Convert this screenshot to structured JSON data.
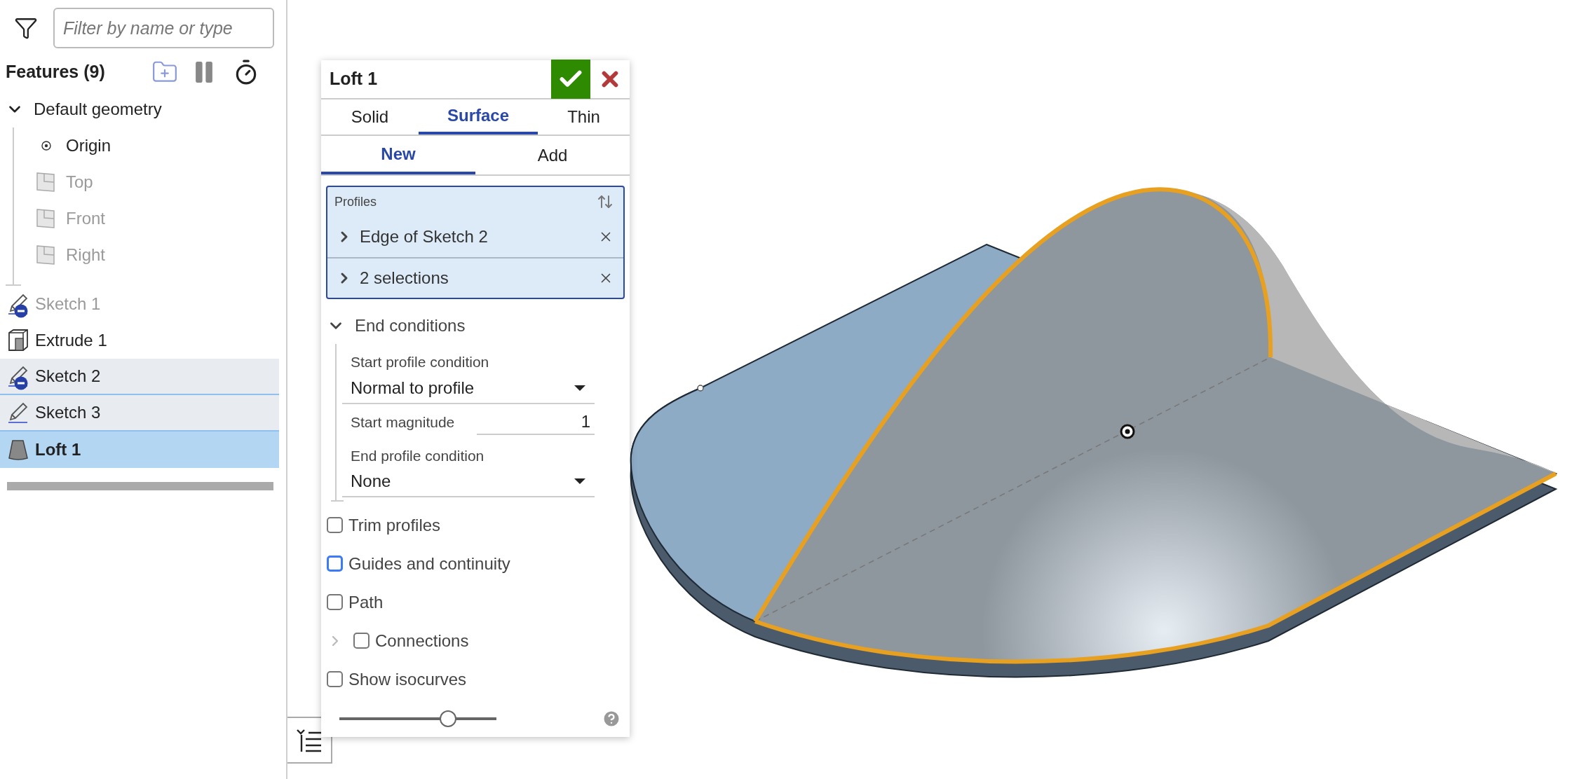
{
  "filter": {
    "placeholder": "Filter by name or type"
  },
  "features": {
    "title": "Features (9)",
    "items": [
      {
        "label": "Default geometry",
        "kind": "group",
        "expanded": true,
        "selected": false,
        "children": [
          {
            "label": "Origin",
            "kind": "point",
            "dimmed": false,
            "selected": false
          },
          {
            "label": "Top",
            "kind": "plane",
            "dimmed": true,
            "selected": false
          },
          {
            "label": "Front",
            "kind": "plane",
            "dimmed": true,
            "selected": false
          },
          {
            "label": "Right",
            "kind": "plane",
            "dimmed": true,
            "selected": false
          }
        ]
      },
      {
        "label": "Sketch 1",
        "kind": "sketch",
        "selected": false,
        "highlighted": false,
        "dimmed": true,
        "hidden": true
      },
      {
        "label": "Extrude 1",
        "kind": "extrude",
        "selected": false,
        "highlighted": false,
        "dimmed": false,
        "hidden": false
      },
      {
        "label": "Sketch 2",
        "kind": "sketch",
        "selected": false,
        "highlighted": true,
        "dimmed": false,
        "hidden": true
      },
      {
        "label": "Sketch 3",
        "kind": "sketch",
        "selected": false,
        "highlighted": true,
        "dimmed": false,
        "hidden": false
      },
      {
        "label": "Loft 1",
        "kind": "loft",
        "selected": true,
        "highlighted": false,
        "dimmed": false,
        "hidden": false
      }
    ]
  },
  "dialog": {
    "title": "Loft 1",
    "tabs": [
      {
        "label": "Solid",
        "selected": false
      },
      {
        "label": "Surface",
        "selected": true
      },
      {
        "label": "Thin",
        "selected": false
      }
    ],
    "sub_tabs": [
      {
        "label": "New",
        "selected": true
      },
      {
        "label": "Add",
        "selected": false
      }
    ],
    "profiles": {
      "label": "Profiles",
      "items": [
        {
          "label": "Edge of Sketch 2"
        },
        {
          "label": "2 selections"
        }
      ]
    },
    "end_conditions": {
      "label": "End conditions",
      "expanded": true,
      "start_condition": {
        "label": "Start profile condition",
        "value": "Normal to profile"
      },
      "start_magnitude": {
        "label": "Start magnitude",
        "value": "1"
      },
      "end_condition": {
        "label": "End profile condition",
        "value": "None"
      }
    },
    "options": [
      {
        "label": "Trim profiles",
        "checked": false,
        "focused": false,
        "expandable": false
      },
      {
        "label": "Guides and continuity",
        "checked": false,
        "focused": true,
        "expandable": false
      },
      {
        "label": "Path",
        "checked": false,
        "focused": false,
        "expandable": false
      },
      {
        "label": "Connections",
        "checked": false,
        "focused": false,
        "expandable": true
      },
      {
        "label": "Show isocurves",
        "checked": false,
        "focused": false,
        "expandable": false
      }
    ],
    "slider": {
      "level": 0.69
    }
  }
}
